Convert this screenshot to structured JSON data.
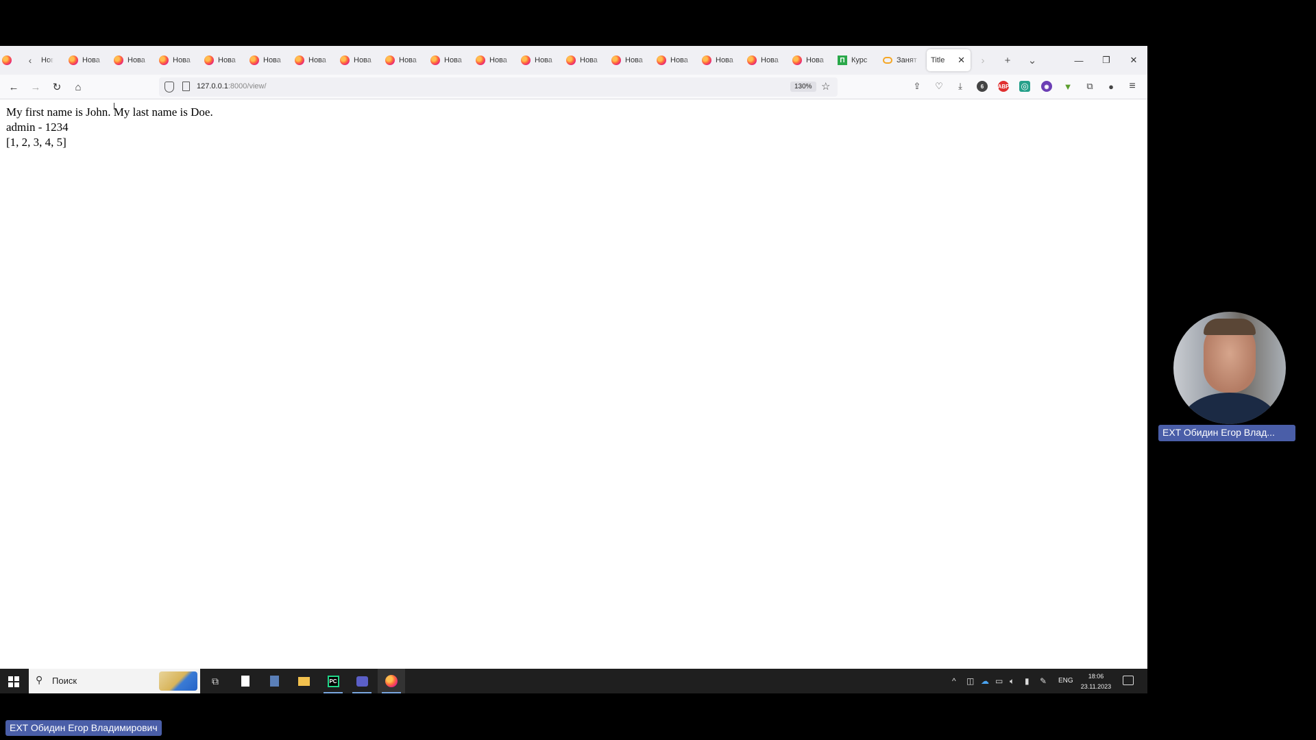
{
  "browser": {
    "tabs_overflow_left_label": "Нова",
    "tabs": [
      {
        "label": "Нова"
      },
      {
        "label": "Нова"
      },
      {
        "label": "Нова"
      },
      {
        "label": "Нова"
      },
      {
        "label": "Нова"
      },
      {
        "label": "Нова"
      },
      {
        "label": "Нова"
      },
      {
        "label": "Нова"
      },
      {
        "label": "Нова"
      },
      {
        "label": "Нова"
      },
      {
        "label": "Нова"
      },
      {
        "label": "Нова"
      },
      {
        "label": "Нова"
      },
      {
        "label": "Нова"
      },
      {
        "label": "Нова"
      },
      {
        "label": "Нова"
      },
      {
        "label": "Нова"
      },
      {
        "label": "Курс",
        "icon": "kurs-icon"
      },
      {
        "label": "Занят",
        "icon": "link-icon"
      }
    ],
    "active_tab": {
      "label": "Title",
      "close": "✕"
    },
    "new_tab": "+",
    "list_tabs": "⌄",
    "window": {
      "minimize": "—",
      "restore": "❐",
      "close": "✕"
    },
    "nav": {
      "back": "←",
      "forward": "→",
      "reload": "↻",
      "home": "⌂"
    },
    "url": {
      "host": "127.0.0.1",
      "rest": ":8000/view/"
    },
    "zoom": "130%",
    "bookmark_star": "☆",
    "menu": "≡"
  },
  "page": {
    "lines": [
      "My first name is John. My last name is Doe.",
      "admin - 1234",
      "[1, 2, 3, 4, 5]"
    ]
  },
  "taskbar": {
    "search_placeholder": "Поиск",
    "language": "ENG",
    "time": "18:06",
    "date": "23.11.2023"
  },
  "video": {
    "participant_name_short": "EXT Обидин Егор Влад...",
    "participant_name_full": "EXT Обидин Егор Владимирович"
  },
  "colors": {
    "accent": "#4a5ea8",
    "tabstrip_bg": "#f0f0f4",
    "taskbar_bg": "#1f1f1f"
  }
}
